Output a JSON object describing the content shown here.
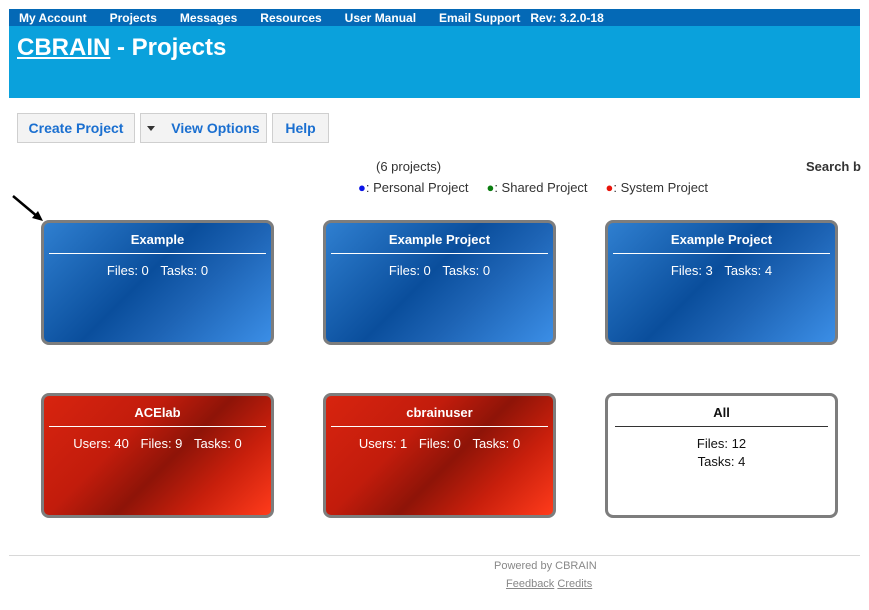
{
  "menu": {
    "items": [
      "My Account",
      "Projects",
      "Messages",
      "Resources",
      "User Manual",
      "Email Support"
    ],
    "rev": "Rev: 3.2.0-18"
  },
  "header": {
    "brand": "CBRAIN",
    "title": "- Projects"
  },
  "buttons": {
    "create": "Create Project",
    "view": "View Options",
    "help": "Help"
  },
  "summary": {
    "count": "(6 projects)",
    "search": "Search b"
  },
  "legend": {
    "personal": {
      "dot": "●",
      "label": ": Personal Project",
      "color": "#0b14e8"
    },
    "shared": {
      "dot": "●",
      "label": ": Shared Project",
      "color": "#0b7d10"
    },
    "system": {
      "dot": "●",
      "label": ": System Project",
      "color": "#e8150b"
    }
  },
  "projects": [
    {
      "name": "Example",
      "type": "personal",
      "stats": [
        "Files: 0",
        "Tasks: 0"
      ]
    },
    {
      "name": "Example Project",
      "type": "personal",
      "stats": [
        "Files: 0",
        "Tasks: 0"
      ]
    },
    {
      "name": "Example Project",
      "type": "personal",
      "stats": [
        "Files: 3",
        "Tasks: 4"
      ]
    },
    {
      "name": "ACElab",
      "type": "system",
      "stats": [
        "Users: 40",
        "Files: 9",
        "Tasks: 0"
      ]
    },
    {
      "name": "cbrainuser",
      "type": "system",
      "stats": [
        "Users: 1",
        "Files: 0",
        "Tasks: 0"
      ]
    },
    {
      "name": "All",
      "type": "all",
      "stats": [
        "Files: 12",
        "Tasks: 4"
      ]
    }
  ],
  "footer": {
    "powered": "Powered by CBRAIN",
    "feedback": "Feedback",
    "credits": "Credits"
  }
}
